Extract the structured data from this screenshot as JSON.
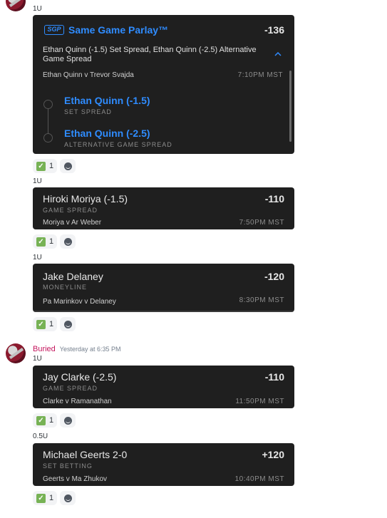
{
  "msg1": {
    "header_time": "Yesterday at 6:35 PM",
    "items": [
      {
        "units": "1U",
        "parlay": {
          "badge": "SGP",
          "title": "Same Game Parlay™",
          "odds": "-136",
          "description": "Ethan Quinn (-1.5) Set Spread, Ethan Quinn (-2.5) Alternative Game Spread",
          "event": "Ethan Quinn v Trevor Svajda",
          "time": "7:10PM MST",
          "legs": [
            {
              "name": "Ethan Quinn (-1.5)",
              "type": "SET SPREAD"
            },
            {
              "name": "Ethan Quinn (-2.5)",
              "type": "ALTERNATIVE GAME SPREAD"
            }
          ]
        },
        "reaction_count": "1"
      },
      {
        "units": "1U",
        "bet": {
          "title": "Hiroki Moriya (-1.5)",
          "odds": "-110",
          "type": "GAME SPREAD",
          "event": "Moriya v Ar Weber",
          "time": "7:50PM MST"
        },
        "reaction_count": "1"
      },
      {
        "units": "1U",
        "bet": {
          "title": "Jake Delaney",
          "odds": "-120",
          "type": "MONEYLINE",
          "event": "Pa Marinkov v Delaney",
          "time": "8:30PM MST"
        },
        "reaction_count": "1"
      }
    ]
  },
  "msg2": {
    "username": "Buried",
    "timestamp": "Yesterday at 6:35 PM",
    "items": [
      {
        "units": "1U",
        "bet": {
          "title": "Jay Clarke (-2.5)",
          "odds": "-110",
          "type": "GAME SPREAD",
          "event": "Clarke v Ramanathan",
          "time": "11:50PM MST"
        },
        "reaction_count": "1"
      },
      {
        "units": "0.5U",
        "bet": {
          "title": "Michael Geerts 2-0",
          "odds": "+120",
          "type": "SET BETTING",
          "event": "Geerts v Ma Zhukov",
          "time": "10:40PM MST"
        },
        "reaction_count": "1"
      }
    ]
  },
  "colors": {
    "username": "#c4145c",
    "accent": "#2f8cff",
    "card_bg": "#1f1f1f",
    "check": "#77b255"
  }
}
